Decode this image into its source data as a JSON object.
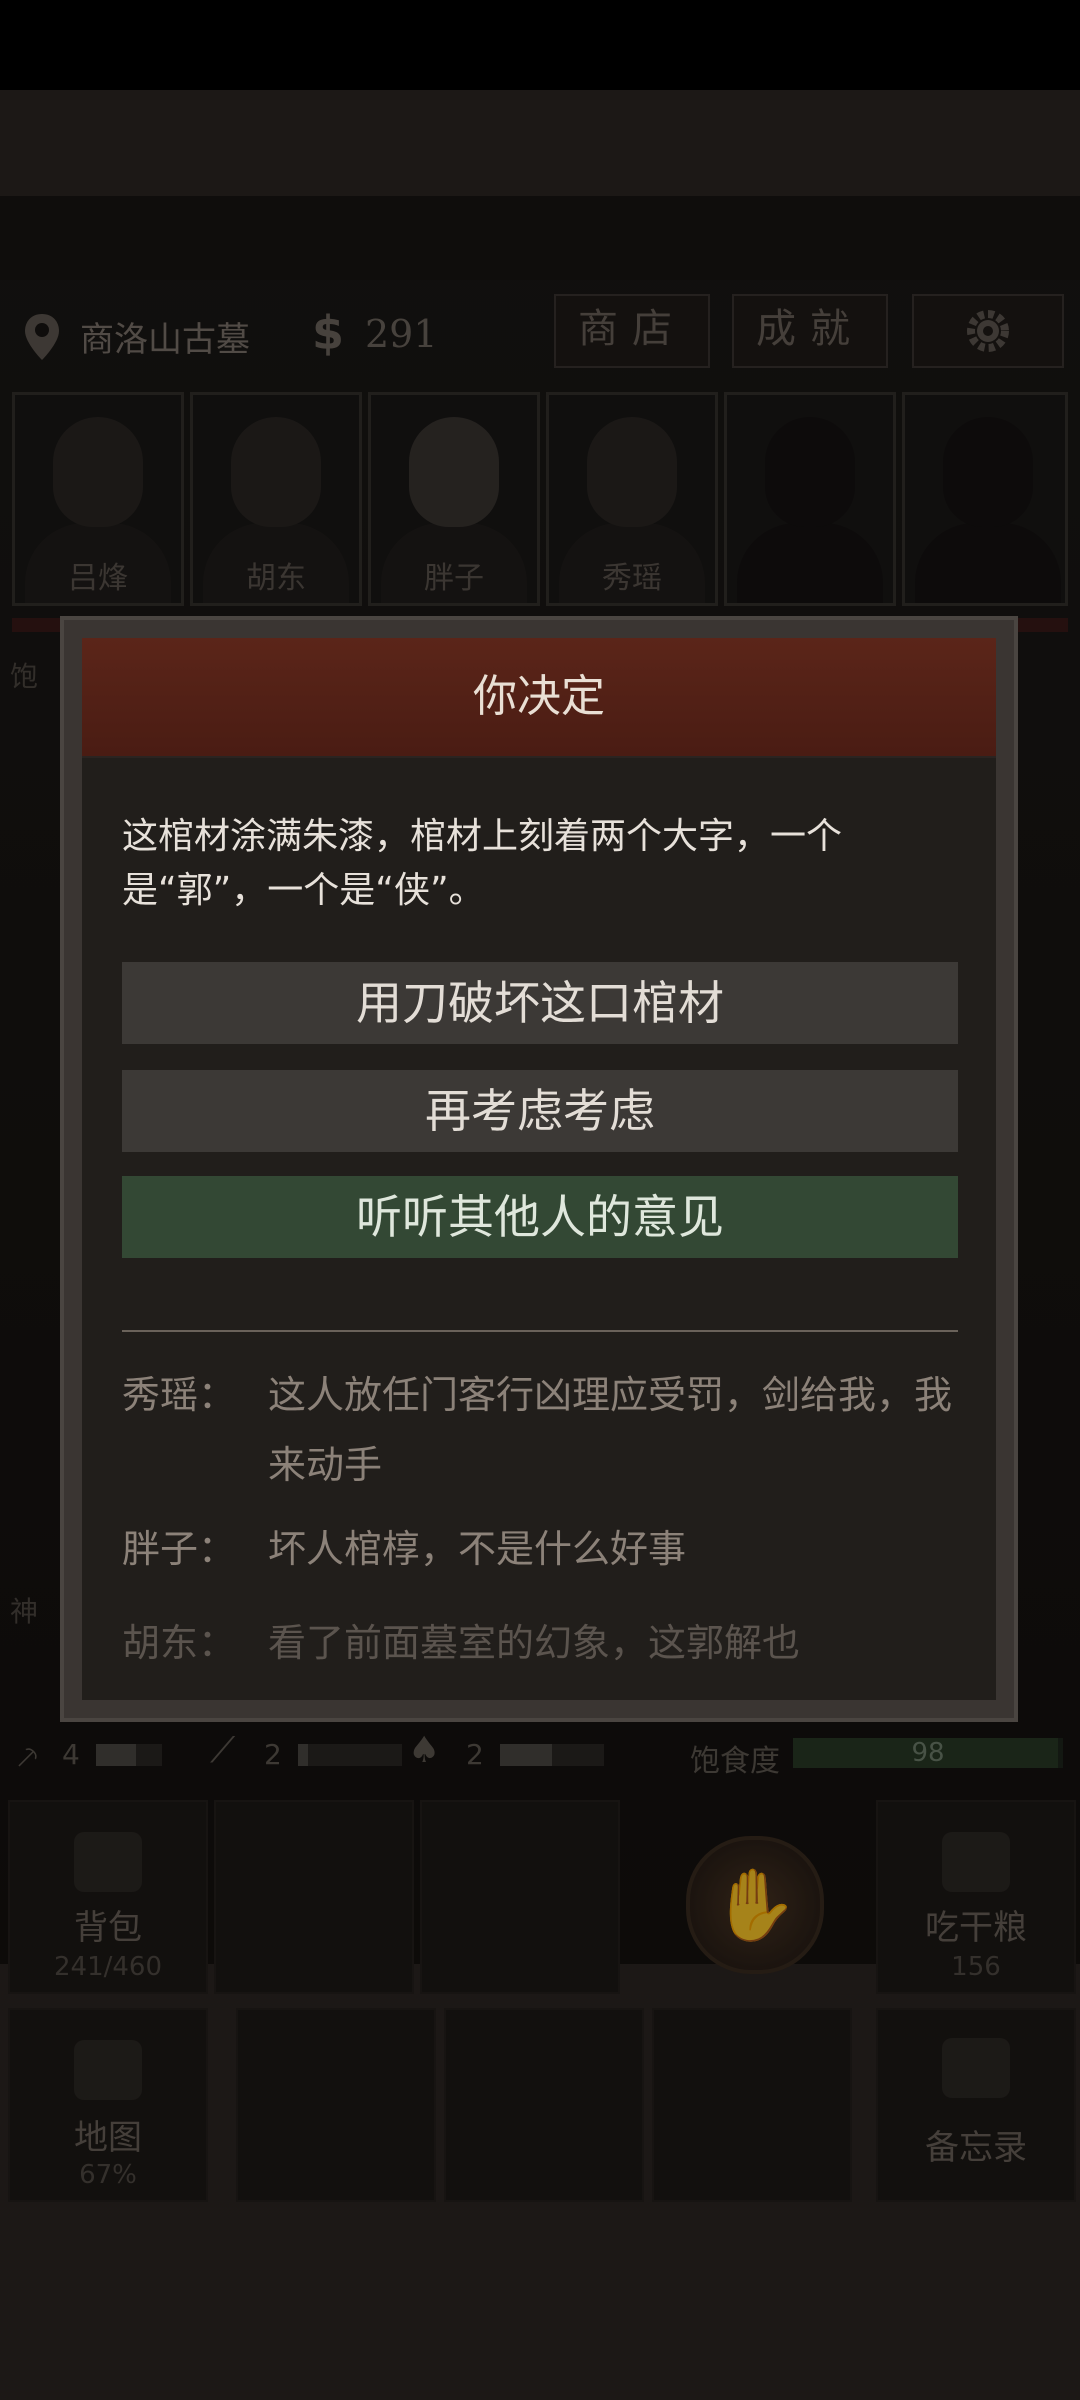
{
  "location": {
    "name": "商洛山古墓"
  },
  "money": {
    "symbol": "$",
    "amount": "291"
  },
  "top_buttons": {
    "shop": "商店",
    "achievements": "成就",
    "settings_icon": "gear-icon"
  },
  "team": [
    {
      "name": "吕烽"
    },
    {
      "name": "胡东"
    },
    {
      "name": "胖子"
    },
    {
      "name": "秀瑶"
    },
    {
      "name": ""
    },
    {
      "name": ""
    }
  ],
  "side": {
    "left_top": "饱",
    "left_mid": "神"
  },
  "stats": {
    "tool1": "4",
    "tool2": "2",
    "tool3": "2",
    "tool1_level": 0.6,
    "tool2_level": 0.1,
    "tool3_level": 0.5,
    "hunger_label": "饱食度",
    "hunger_value": "98",
    "hunger_fraction": 0.98
  },
  "grid": {
    "bag": {
      "label": "背包",
      "sub": "241/460"
    },
    "eat": {
      "label": "吃干粮",
      "sub": "156"
    },
    "map": {
      "label": "地图",
      "sub": "67%"
    },
    "memo": {
      "label": "备忘录"
    }
  },
  "dialog": {
    "title": "你决定",
    "description": "这棺材涂满朱漆，棺材上刻着两个大字，一个是“郭”，一个是“侠”。",
    "choices": [
      "用刀破坏这口棺材",
      "再考虑考虑",
      "听听其他人的意见"
    ],
    "comments": [
      {
        "who": "秀瑶：",
        "text": "这人放任门客行凶理应受罚，剑给我，我来动手"
      },
      {
        "who": "胖子：",
        "text": "坏人棺椁，不是什么好事"
      },
      {
        "who": "胡东：",
        "text": "看了前面墓室的幻象，这郭解也"
      }
    ]
  },
  "colors": {
    "header_red": "#5b2519",
    "choice_green": "#334834",
    "choice_gray": "#3c3936"
  }
}
